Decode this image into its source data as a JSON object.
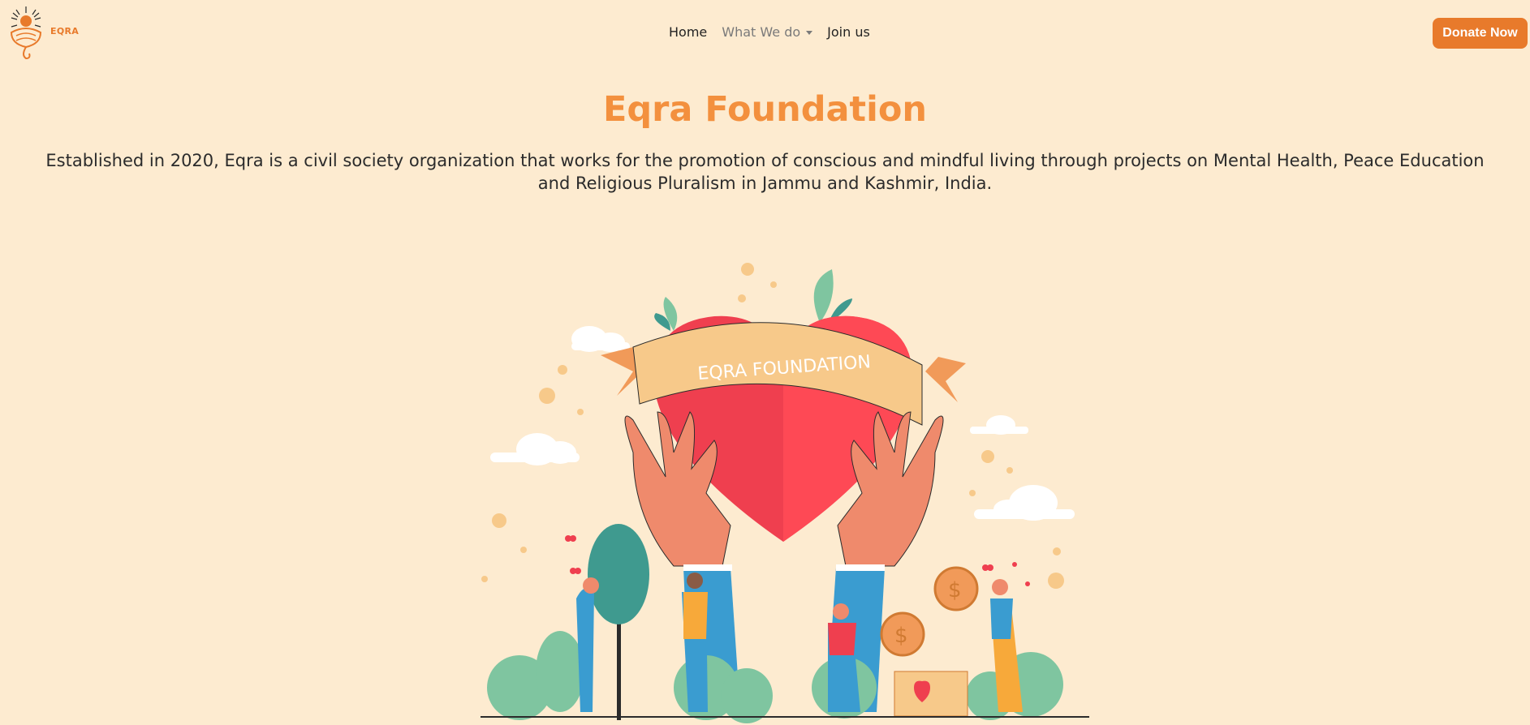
{
  "brand": {
    "name": "EQRA",
    "logo_icon": "sun-lotus-logo-icon"
  },
  "nav": {
    "items": [
      {
        "label": "Home",
        "muted": false
      },
      {
        "label": "What We do",
        "muted": true,
        "dropdown": true
      },
      {
        "label": "Join us",
        "muted": false
      }
    ],
    "donate_label": "Donate Now"
  },
  "hero": {
    "title": "Eqra Foundation",
    "description": "Established in 2020, Eqra is a civil society organization that works for the promotion of conscious and mindful living through projects on Mental Health, Peace Education and Religious Pluralism in Jammu and Kashmir, India."
  },
  "illustration": {
    "banner_text": "EQRA FOUNDATION"
  },
  "colors": {
    "background": "#fdebd0",
    "accent": "#e87a2b",
    "title": "#f3903e",
    "heart": "#ef3f4f",
    "leaf": "#7fc5a0"
  }
}
